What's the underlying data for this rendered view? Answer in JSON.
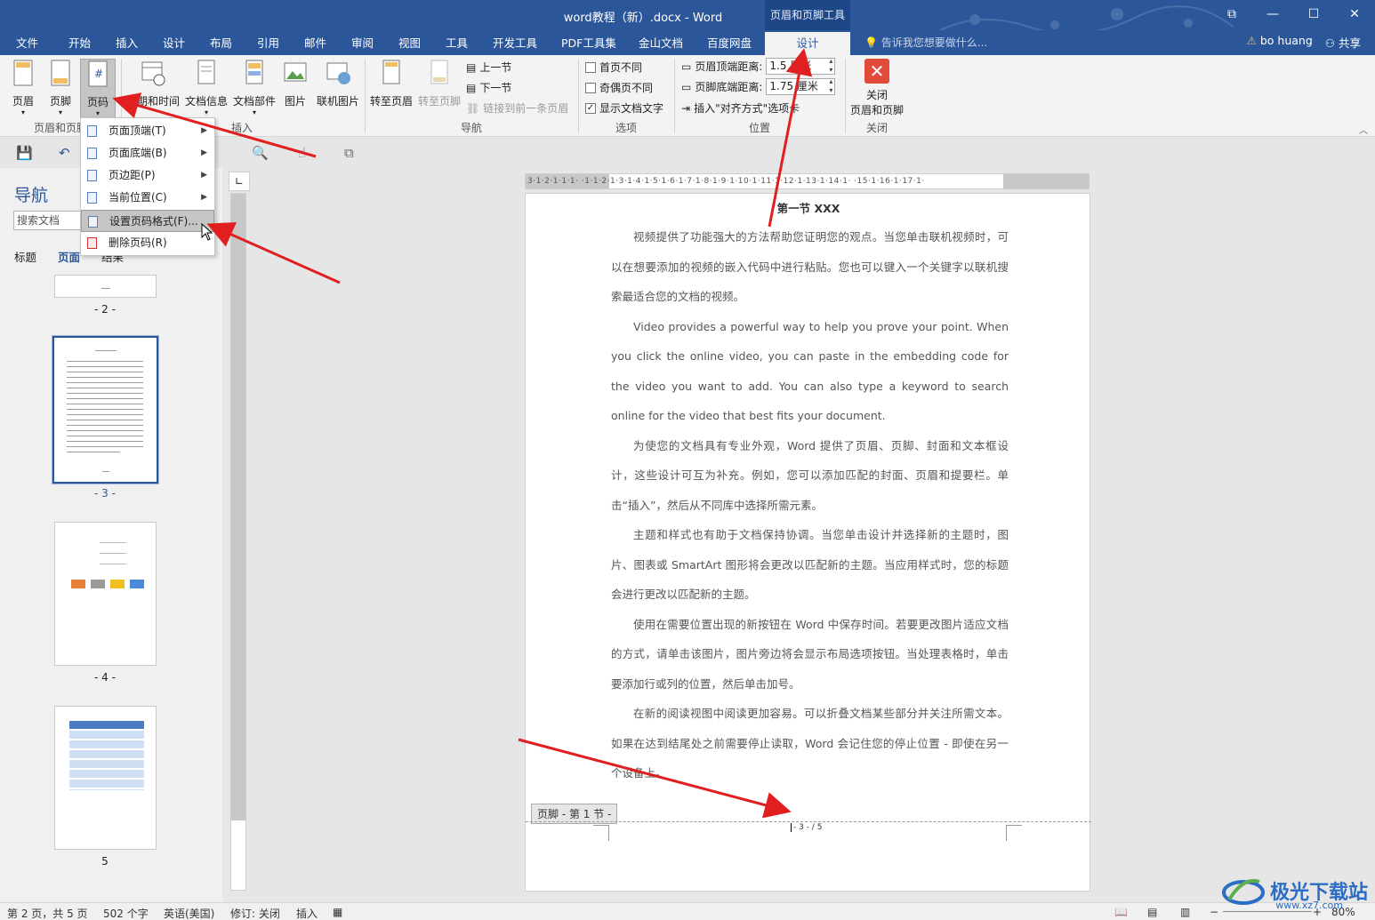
{
  "window": {
    "title": "word教程（新）.docx - Word",
    "context_tab_group": "页眉和页脚工具",
    "controls": [
      "⧉",
      "—",
      "☐",
      "✕"
    ]
  },
  "tabs": [
    "文件",
    "开始",
    "插入",
    "设计",
    "布局",
    "引用",
    "邮件",
    "审阅",
    "视图",
    "工具",
    "开发工具",
    "PDF工具集",
    "金山文档",
    "百度网盘",
    "设计"
  ],
  "active_tab_index": 14,
  "tell_me": "告诉我您想要做什么...",
  "user": {
    "name": "bo huang",
    "share": "共享"
  },
  "ribbon": {
    "header": "页眉",
    "footer": "页脚",
    "page_number": "页码",
    "group_header_footer": "页眉和页脚",
    "date_time": "日期和时间",
    "doc_info": "文档信息",
    "doc_parts": "文档部件",
    "picture": "图片",
    "online_picture": "联机图片",
    "group_insert": "插入",
    "goto_header": "转至页眉",
    "goto_footer": "转至页脚",
    "prev_section": "上一节",
    "next_section": "下一节",
    "link_prev": "链接到前一条页眉",
    "group_nav": "导航",
    "diff_first": "首页不同",
    "diff_odd_even": "奇偶页不同",
    "show_doc_text": "显示文档文字",
    "group_options": "选项",
    "header_top_label": "页眉顶端距离:",
    "header_top_value": "1.5 厘米",
    "footer_bottom_label": "页脚底端距离:",
    "footer_bottom_value": "1.75 厘米",
    "insert_align_tab": "插入\"对齐方式\"选项卡",
    "group_position": "位置",
    "close_line1": "关闭",
    "close_line2": "页眉和页脚",
    "group_close": "关闭"
  },
  "dropdown_menu": [
    {
      "label": "页面顶端(T)",
      "submenu": true
    },
    {
      "label": "页面底端(B)",
      "submenu": true
    },
    {
      "label": "页边距(P)",
      "submenu": true
    },
    {
      "label": "当前位置(C)",
      "submenu": true
    },
    {
      "label": "设置页码格式(F)...",
      "submenu": false
    },
    {
      "label": "删除页码(R)",
      "submenu": false
    }
  ],
  "navigation": {
    "title": "导航",
    "search_placeholder": "搜索文档",
    "tabs": [
      "标题",
      "页面",
      "结果"
    ],
    "pages": [
      "- 2 -",
      "- 3 -",
      "- 4 -",
      "5"
    ],
    "selected_page_index": 1
  },
  "ruler_text": "3·1·2·1·1·1·   ·1·1·2·1·3·1·4·1·5·1·6·1·7·1·8·1·9·1·10·1·11·1·12·1·13·1·14·1·   ·15·1·16·1·17·1·",
  "document": {
    "heading": "第一节  XXX",
    "paragraphs": [
      "视频提供了功能强大的方法帮助您证明您的观点。当您单击联机视频时，可以在想要添加的视频的嵌入代码中进行粘贴。您也可以键入一个关键字以联机搜索最适合您的文档的视频。",
      "Video provides a powerful way to help you prove your point. When you click the online video, you can paste in the embedding code for the video you want to add. You can also type a keyword to search online for the video that best fits your document.",
      "为使您的文档具有专业外观，Word 提供了页眉、页脚、封面和文本框设计，这些设计可互为补充。例如，您可以添加匹配的封面、页眉和提要栏。单击“插入”，然后从不同库中选择所需元素。",
      "主题和样式也有助于文档保持协调。当您单击设计并选择新的主题时，图片、图表或 SmartArt 图形将会更改以匹配新的主题。当应用样式时，您的标题会进行更改以匹配新的主题。",
      "使用在需要位置出现的新按钮在 Word 中保存时间。若要更改图片适应文档的方式，请单击该图片，图片旁边将会显示布局选项按钮。当处理表格时，单击要添加行或列的位置，然后单击加号。",
      "在新的阅读视图中阅读更加容易。可以折叠文档某些部分并关注所需文本。如果在达到结尾处之前需要停止读取，Word 会记住您的停止位置 - 即使在另一个设备上。"
    ],
    "footer_tag": "页脚 - 第 1 节 -",
    "page_number": "- 3 - / 5"
  },
  "status_bar": {
    "page": "第 2 页，共 5 页",
    "words": "502 个字",
    "lang": "英语(美国)",
    "track": "修订: 关闭",
    "mode": "插入",
    "zoom": "80%"
  },
  "watermark": {
    "brand": "极光下载站",
    "url": "www.xz7.com"
  },
  "colors": {
    "accent": "#2b579a",
    "arrow": "#e02020"
  }
}
